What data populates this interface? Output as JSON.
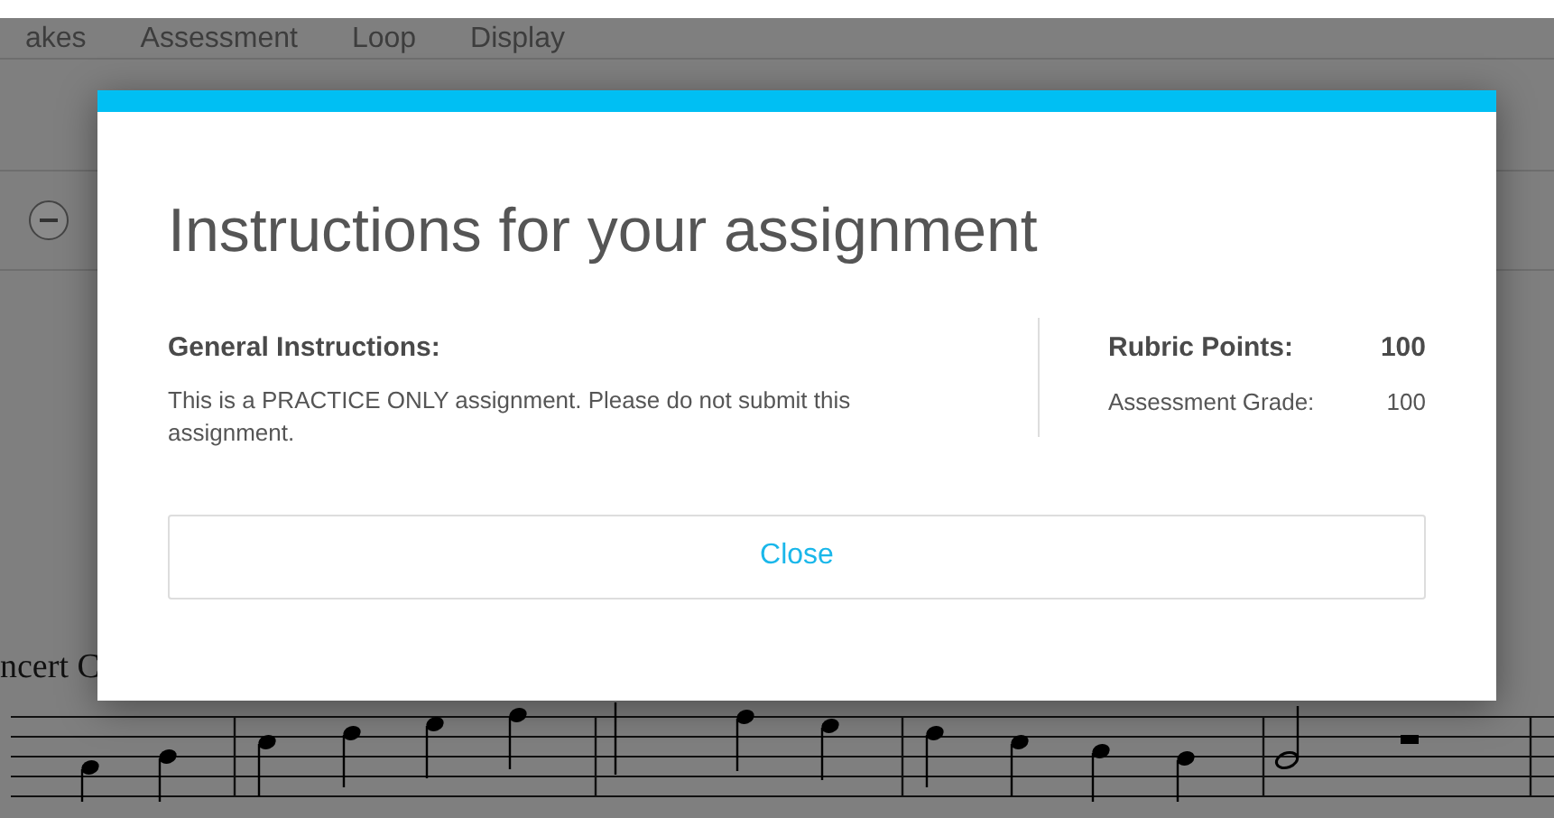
{
  "background": {
    "menu": [
      "akes",
      "Assessment",
      "Loop",
      "Display"
    ],
    "score_label": "ncert C"
  },
  "dialog": {
    "title": "Instructions for your assignment",
    "general_heading": "General Instructions:",
    "general_text": "This is a PRACTICE ONLY assignment. Please do not submit this assignment.",
    "rubric_label": "Rubric Points:",
    "rubric_value": "100",
    "grade_label": "Assessment Grade:",
    "grade_value": "100",
    "close_button": "Close"
  }
}
